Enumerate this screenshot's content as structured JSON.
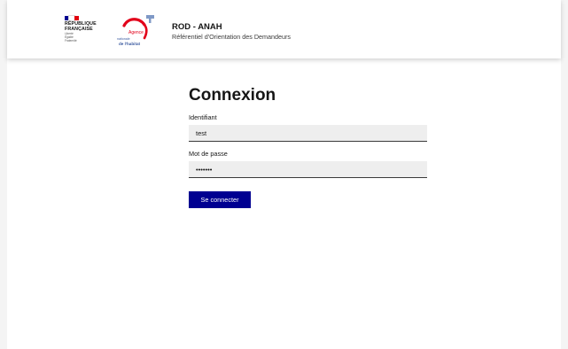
{
  "header": {
    "republique_lines": [
      "RÉPUBLIQUE",
      "FRANÇAISE"
    ],
    "motto_lines": [
      "Liberté",
      "Égalité",
      "Fraternité"
    ],
    "anah_logo_lines": [
      "Agence",
      "nationale",
      "de l'habitat"
    ],
    "app_title": "ROD - ANAH",
    "app_subtitle": "Référentiel d'Orientation des Demandeurs"
  },
  "login": {
    "heading": "Connexion",
    "identifier_label": "Identifiant",
    "identifier_value": "test",
    "password_label": "Mot de passe",
    "password_value": "•••••••",
    "submit_label": "Se connecter"
  },
  "colors": {
    "primary_button": "#000091",
    "anah_red": "#e2001a",
    "input_background": "#eeeeee"
  }
}
